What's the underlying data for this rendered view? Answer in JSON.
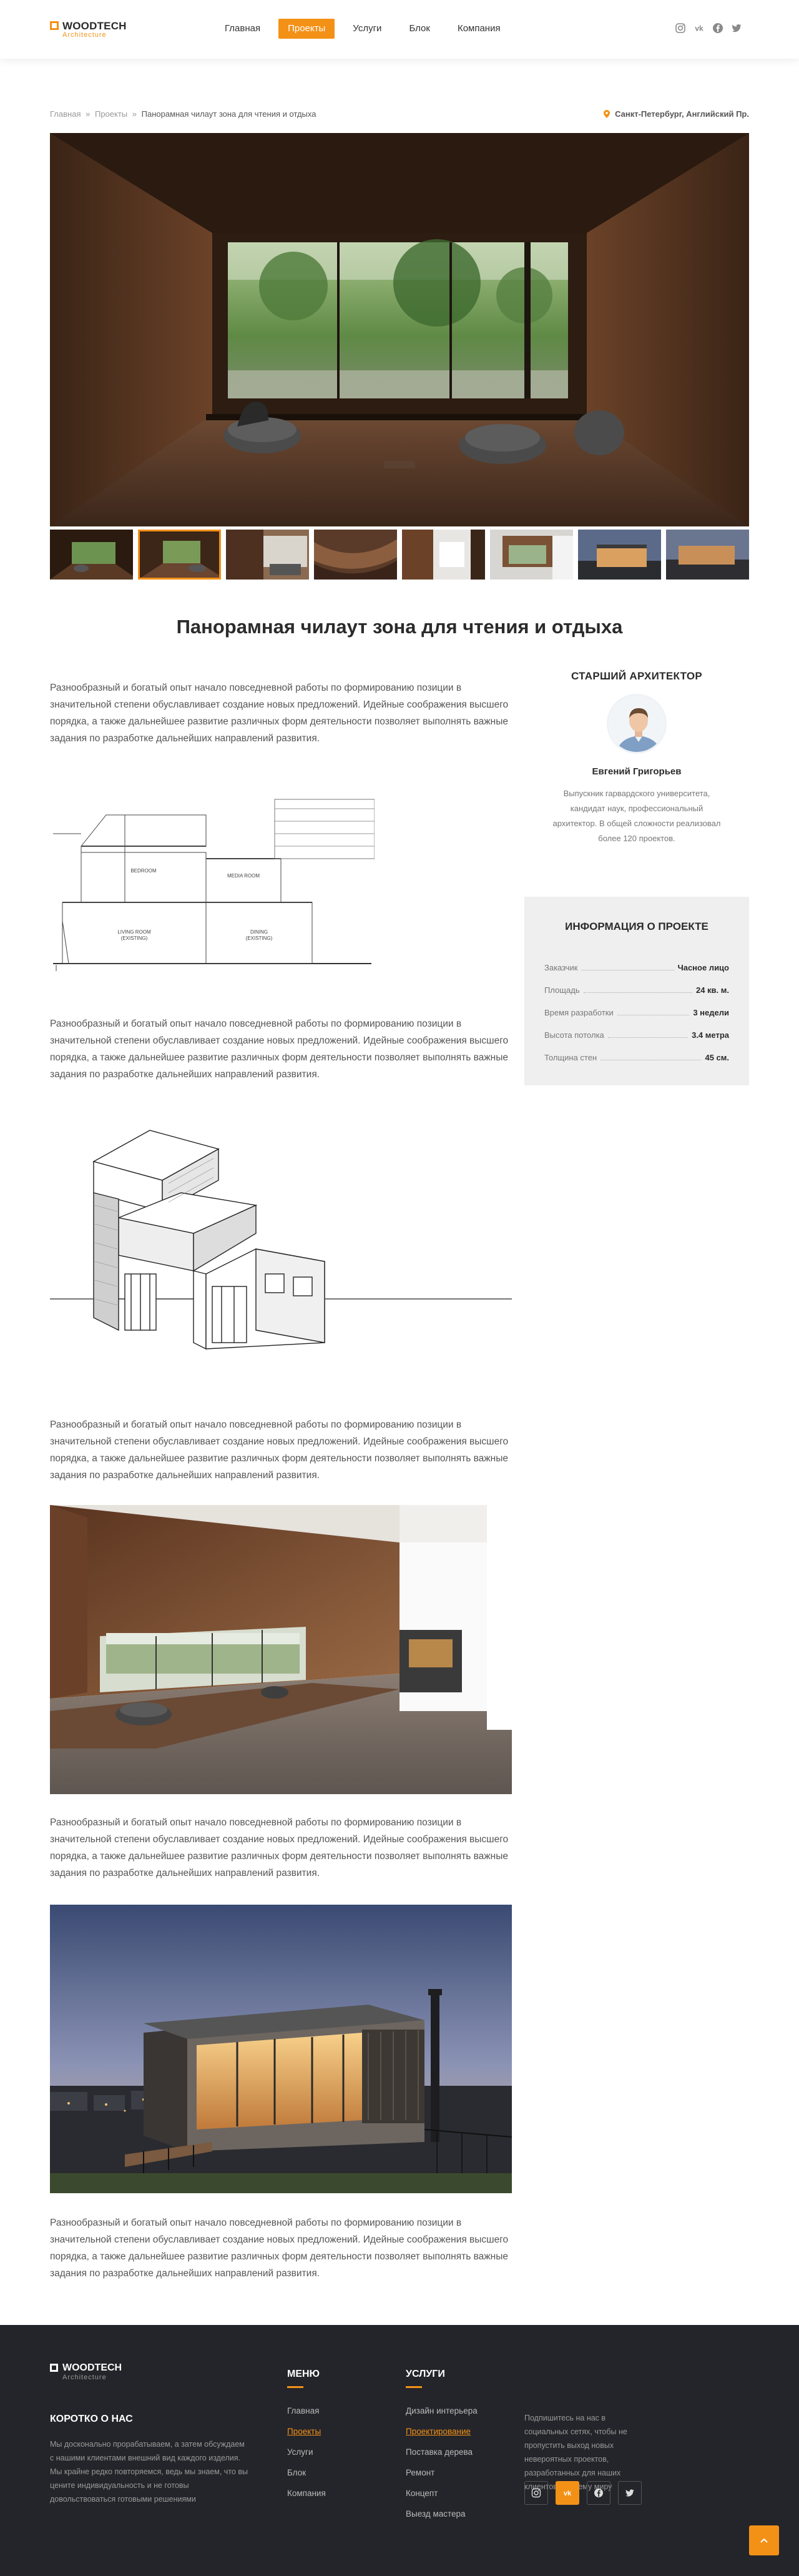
{
  "header": {
    "logo": {
      "name": "WOODTECH",
      "sub": "Architecture"
    },
    "nav": [
      {
        "label": "Главная",
        "active": false
      },
      {
        "label": "Проекты",
        "active": true
      },
      {
        "label": "Услуги",
        "active": false
      },
      {
        "label": "Блок",
        "active": false
      },
      {
        "label": "Компания",
        "active": false
      }
    ],
    "socials": [
      "instagram-icon",
      "vk-icon",
      "facebook-icon",
      "twitter-icon"
    ]
  },
  "breadcrumb": {
    "items": [
      "Главная",
      "Проекты"
    ],
    "separator": "»",
    "current": "Панорамная чилаут зона для чтения и отдыха"
  },
  "location": "Санкт-Петербург, Английский Пр.",
  "project": {
    "title": "Панорамная чилаут зона для чтения и отдыха",
    "paragraph": "Разнообразный и богатый опыт начало повседневной работы по формированию позиции в значительной степени обуславливает создание новых предложений. Идейные соображения высшего порядка, а также дальнейшее развитие различных форм деятельности позволяет выполнять важные задания по разработке дальнейших направлений развития.",
    "section_labels": {
      "bedroom": "BEDROOM",
      "media": "MEDIA ROOM",
      "living": "LIVING ROOM (EXISTING)",
      "dining": "DINING (EXISTING)"
    }
  },
  "architect": {
    "heading": "Старший архитектор",
    "name": "Евгений Григорьев",
    "bio": "Выпускник гарвардского университета, кандидат наук, профессиональный архитектор. В общей сложности реализовал более 120 проектов."
  },
  "info": {
    "heading": "Информация о проекте",
    "rows": [
      {
        "key": "Заказчик",
        "value": "Часное лицо"
      },
      {
        "key": "Площадь",
        "value": "24 кв. м."
      },
      {
        "key": "Время разработки",
        "value": "3 недели"
      },
      {
        "key": "Высота потолка",
        "value": "3.4 метра"
      },
      {
        "key": "Толщина стен",
        "value": "45 см."
      }
    ]
  },
  "colors": {
    "accent": "#f39117",
    "footer_bg": "#24252a"
  },
  "footer": {
    "logo": {
      "name": "WOODTECH",
      "sub": "Architecture"
    },
    "about_title": "Коротко о нас",
    "about_text": "Мы досконально прорабатываем, а затем обсуждаем с нашими клиентами внешний вид каждого изделия. Мы крайне редко повторяемся, ведь мы знаем, что вы цените индивидуальность и не готовы довольствоваться готовыми решениями",
    "menu_title": "Меню",
    "menu": [
      {
        "label": "Главная",
        "active": false
      },
      {
        "label": "Проекты",
        "active": true
      },
      {
        "label": "Услуги",
        "active": false
      },
      {
        "label": "Блок",
        "active": false
      },
      {
        "label": "Компания",
        "active": false
      }
    ],
    "services_title": "Услуги",
    "services": [
      {
        "label": "Дизайн интерьера",
        "active": false
      },
      {
        "label": "Проектирование",
        "active": true
      },
      {
        "label": "Поставка дерева",
        "active": false
      },
      {
        "label": "Ремонт",
        "active": false
      },
      {
        "label": "Концепт",
        "active": false
      },
      {
        "label": "Выезд мастера",
        "active": false
      }
    ],
    "subscribe_text": "Подпишитесь на нас в социальных сетях, чтобы не пропустить выход новых невероятных проектов, разработанных для наших клиентов по всему миру",
    "socials": [
      "instagram-icon",
      "vk-icon",
      "facebook-icon",
      "twitter-icon"
    ]
  }
}
